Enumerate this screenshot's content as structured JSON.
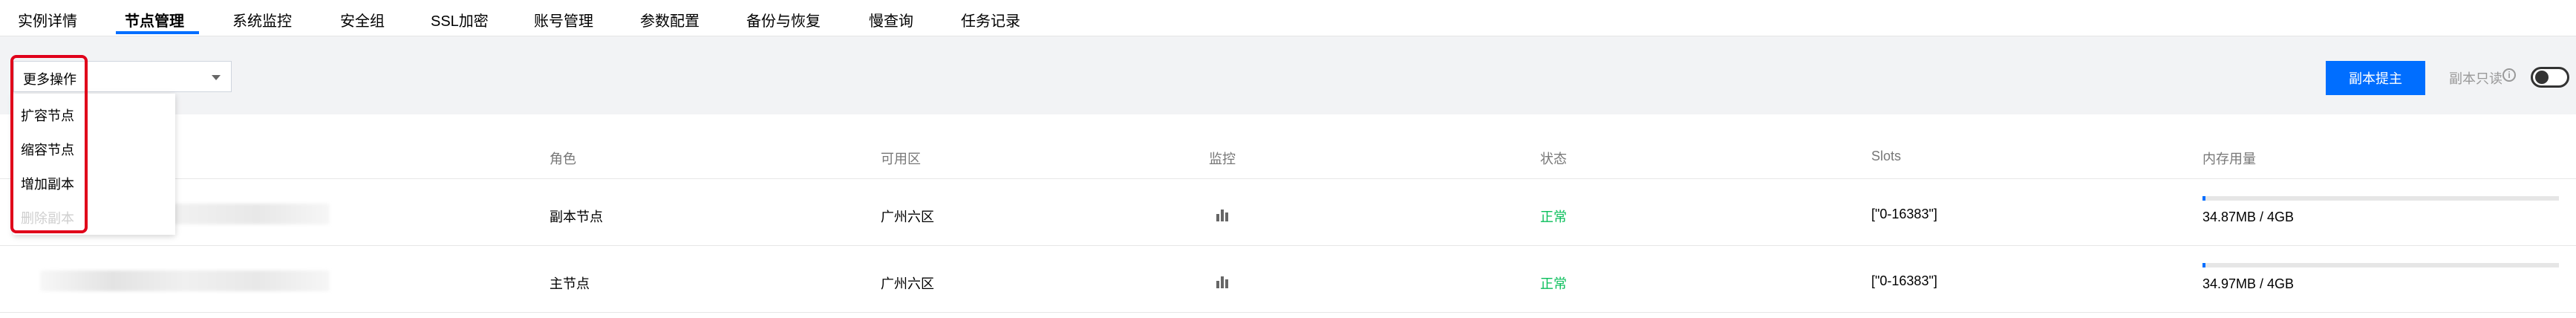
{
  "tabs": [
    {
      "label": "实例详情"
    },
    {
      "label": "节点管理"
    },
    {
      "label": "系统监控"
    },
    {
      "label": "安全组"
    },
    {
      "label": "SSL加密"
    },
    {
      "label": "账号管理"
    },
    {
      "label": "参数配置"
    },
    {
      "label": "备份与恢复"
    },
    {
      "label": "慢查询"
    },
    {
      "label": "任务记录"
    }
  ],
  "active_tab": "节点管理",
  "toolbar": {
    "more_actions": "更多操作",
    "primary_button": "副本提主",
    "readonly_toggle_label": "副本只读",
    "readonly_toggle_on": false
  },
  "dropdown_menu": {
    "items": [
      {
        "label": "扩容节点",
        "disabled": false
      },
      {
        "label": "缩容节点",
        "disabled": false
      },
      {
        "label": "增加副本",
        "disabled": false
      },
      {
        "label": "删除副本",
        "disabled": true
      }
    ]
  },
  "table": {
    "columns": [
      "角色",
      "可用区",
      "监控",
      "状态",
      "Slots",
      "内存用量"
    ],
    "rows": [
      {
        "role": "副本节点",
        "zone": "广州六区",
        "monitor_icon": "bar-chart-icon",
        "status": "正常",
        "slots": "[\"0-16383\"]",
        "memory": "34.87MB / 4GB",
        "memory_fraction": 0.0085
      },
      {
        "role": "主节点",
        "zone": "广州六区",
        "monitor_icon": "bar-chart-icon",
        "status": "正常",
        "slots": "[\"0-16383\"]",
        "memory": "34.97MB / 4GB",
        "memory_fraction": 0.0085
      }
    ]
  },
  "colors": {
    "accent": "#006eff",
    "status_ok": "#0abf5b",
    "highlight": "#e0001a"
  }
}
